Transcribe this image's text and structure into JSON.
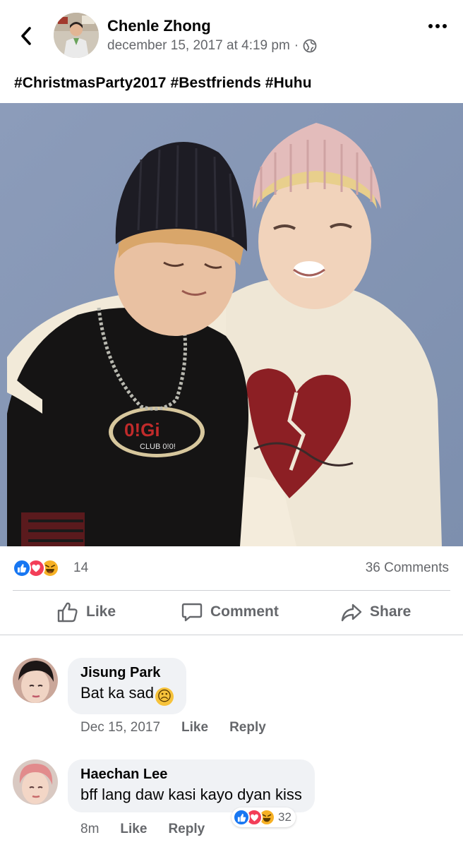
{
  "post": {
    "author": "Chenle Zhong",
    "timestamp": "december 15, 2017 at 4:19 pm",
    "separator": "·",
    "privacy_icon": "globe-icon",
    "caption": "#ChristmasParty2017 #Bestfriends #Huhu"
  },
  "reactions": {
    "icons": [
      "like-icon",
      "love-icon",
      "haha-icon"
    ],
    "count": "14",
    "comments_label": "36 Comments"
  },
  "actions": {
    "like": "Like",
    "comment": "Comment",
    "share": "Share"
  },
  "comments": [
    {
      "name": "Jisung Park",
      "text": "Bat ka sad",
      "emoji": "☹",
      "time": "Dec 15, 2017",
      "like": "Like",
      "reply": "Reply"
    },
    {
      "name": "Haechan Lee",
      "text": "bff lang daw kasi kayo dyan kiss",
      "time": "8m",
      "like": "Like",
      "reply": "Reply",
      "reaction_count": "32"
    }
  ],
  "colors": {
    "like_blue": "#1877f2",
    "love_red": "#f33e58",
    "haha_yellow": "#f7b125",
    "secondary_text": "#65676b",
    "bubble_bg": "#f0f2f5"
  }
}
